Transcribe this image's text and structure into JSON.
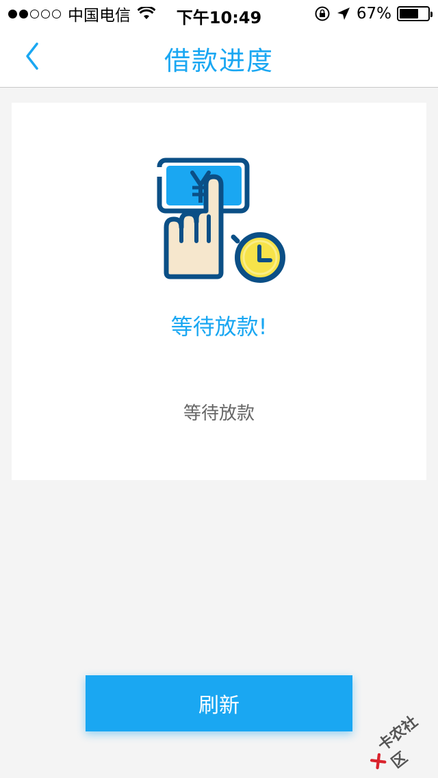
{
  "status_bar": {
    "carrier": "中国电信",
    "time": "下午10:49",
    "battery": "67%",
    "battery_level": 0.67,
    "signal_bars_filled": 2,
    "signal_bars_total": 5
  },
  "nav": {
    "title": "借款进度",
    "back_icon": "chevron-left-icon"
  },
  "card": {
    "illustration_icon": "cash-finger-clock-icon",
    "heading": "等待放款!",
    "description": "等待放款"
  },
  "actions": {
    "refresh_label": "刷新"
  },
  "watermark": {
    "text": "卡农社区"
  },
  "colors": {
    "accent": "#1aa7f2",
    "background": "#f4f4f4",
    "card": "#ffffff",
    "illustration_dark": "#0b4f86",
    "illustration_blue": "#1aa7f2",
    "hand": "#f6e7cd",
    "clock": "#f7e34a"
  }
}
